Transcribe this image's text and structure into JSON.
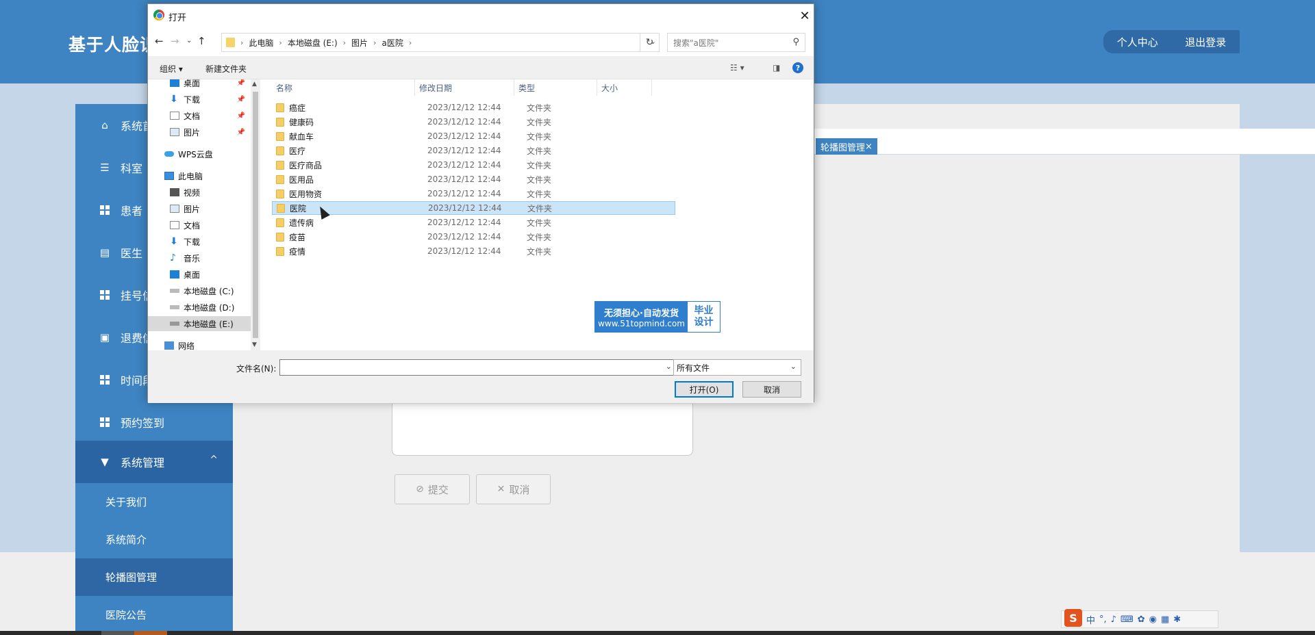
{
  "app": {
    "title": "基于人脸识",
    "header_actions": [
      "个人中心",
      "退出登录"
    ],
    "sidebar": [
      {
        "label": "系统首",
        "icon": "home-icon"
      },
      {
        "label": "科室",
        "icon": "sliders-icon"
      },
      {
        "label": "患者",
        "icon": "grid-icon"
      },
      {
        "label": "医生",
        "icon": "clipboard-icon"
      },
      {
        "label": "挂号信",
        "icon": "grid-icon"
      },
      {
        "label": "退费信",
        "icon": "briefcase-icon"
      },
      {
        "label": "时间段",
        "icon": "grid-icon"
      },
      {
        "label": "预约签到",
        "icon": "grid-icon"
      },
      {
        "label": "系统管理",
        "icon": "brush-icon",
        "chevron": "^"
      }
    ],
    "submenu": [
      "关于我们",
      "系统简介",
      "轮播图管理",
      "医院公告"
    ],
    "active_submenu": "轮播图管理",
    "open_tab": "轮播图管理",
    "tab_close": "×",
    "submit_label": "提交",
    "cancel_label": "取消"
  },
  "dialog": {
    "title": "打开",
    "breadcrumbs": [
      "此电脑",
      "本地磁盘 (E:)",
      "图片",
      "a医院"
    ],
    "search_placeholder": "搜索\"a医院\"",
    "toolbar": {
      "organize": "组织 ▾",
      "new_folder": "新建文件夹"
    },
    "nav_pane": [
      {
        "label": "桌面",
        "icon": "desktop-icon",
        "pinned": true
      },
      {
        "label": "下载",
        "icon": "download-icon",
        "pinned": true
      },
      {
        "label": "文档",
        "icon": "document-icon",
        "pinned": true
      },
      {
        "label": "图片",
        "icon": "picture-icon",
        "pinned": true
      },
      {
        "label": "WPS云盘",
        "icon": "cloud-icon",
        "pinned": false
      },
      {
        "label": "此电脑",
        "icon": "computer-icon",
        "pinned": false
      },
      {
        "label": "视频",
        "icon": "video-icon",
        "pinned": false
      },
      {
        "label": "图片",
        "icon": "picture-icon",
        "pinned": false
      },
      {
        "label": "文档",
        "icon": "document-icon",
        "pinned": false
      },
      {
        "label": "下载",
        "icon": "download-icon",
        "pinned": false
      },
      {
        "label": "音乐",
        "icon": "music-icon",
        "pinned": false
      },
      {
        "label": "桌面",
        "icon": "desktop-icon",
        "pinned": false
      },
      {
        "label": "本地磁盘 (C:)",
        "icon": "drive-icon",
        "pinned": false
      },
      {
        "label": "本地磁盘 (D:)",
        "icon": "drive-icon",
        "pinned": false
      },
      {
        "label": "本地磁盘 (E:)",
        "icon": "drive-icon",
        "pinned": false,
        "selected": true
      },
      {
        "label": "网络",
        "icon": "network-icon",
        "pinned": false
      }
    ],
    "columns": [
      "名称",
      "修改日期",
      "类型",
      "大小"
    ],
    "files": [
      {
        "name": "癌症",
        "date": "2023/12/12 12:44",
        "type": "文件夹"
      },
      {
        "name": "健康码",
        "date": "2023/12/12 12:44",
        "type": "文件夹"
      },
      {
        "name": "献血车",
        "date": "2023/12/12 12:44",
        "type": "文件夹"
      },
      {
        "name": "医疗",
        "date": "2023/12/12 12:44",
        "type": "文件夹"
      },
      {
        "name": "医疗商品",
        "date": "2023/12/12 12:44",
        "type": "文件夹"
      },
      {
        "name": "医用品",
        "date": "2023/12/12 12:44",
        "type": "文件夹"
      },
      {
        "name": "医用物资",
        "date": "2023/12/12 12:44",
        "type": "文件夹"
      },
      {
        "name": "医院",
        "date": "2023/12/12 12:44",
        "type": "文件夹",
        "selected": true
      },
      {
        "name": "遗传病",
        "date": "2023/12/12 12:44",
        "type": "文件夹"
      },
      {
        "name": "疫苗",
        "date": "2023/12/12 12:44",
        "type": "文件夹"
      },
      {
        "name": "疫情",
        "date": "2023/12/12 12:44",
        "type": "文件夹"
      }
    ],
    "filename_label": "文件名(N):",
    "filename_value": "",
    "filter_value": "所有文件",
    "open_button": "打开(O)",
    "cancel_button": "取消"
  },
  "watermark": {
    "line1": "无须担心·自动发货",
    "line2": "www.51topmind.com",
    "badge1": "毕业",
    "badge2": "设计"
  },
  "ime": {
    "logo": "S",
    "mode": "中",
    "punct": "°,"
  },
  "colors": {
    "header_blue": "#3e84c2",
    "sidebar_active": "#2a64a3",
    "selection": "#cce4f7",
    "folder": "#f5cf65"
  }
}
